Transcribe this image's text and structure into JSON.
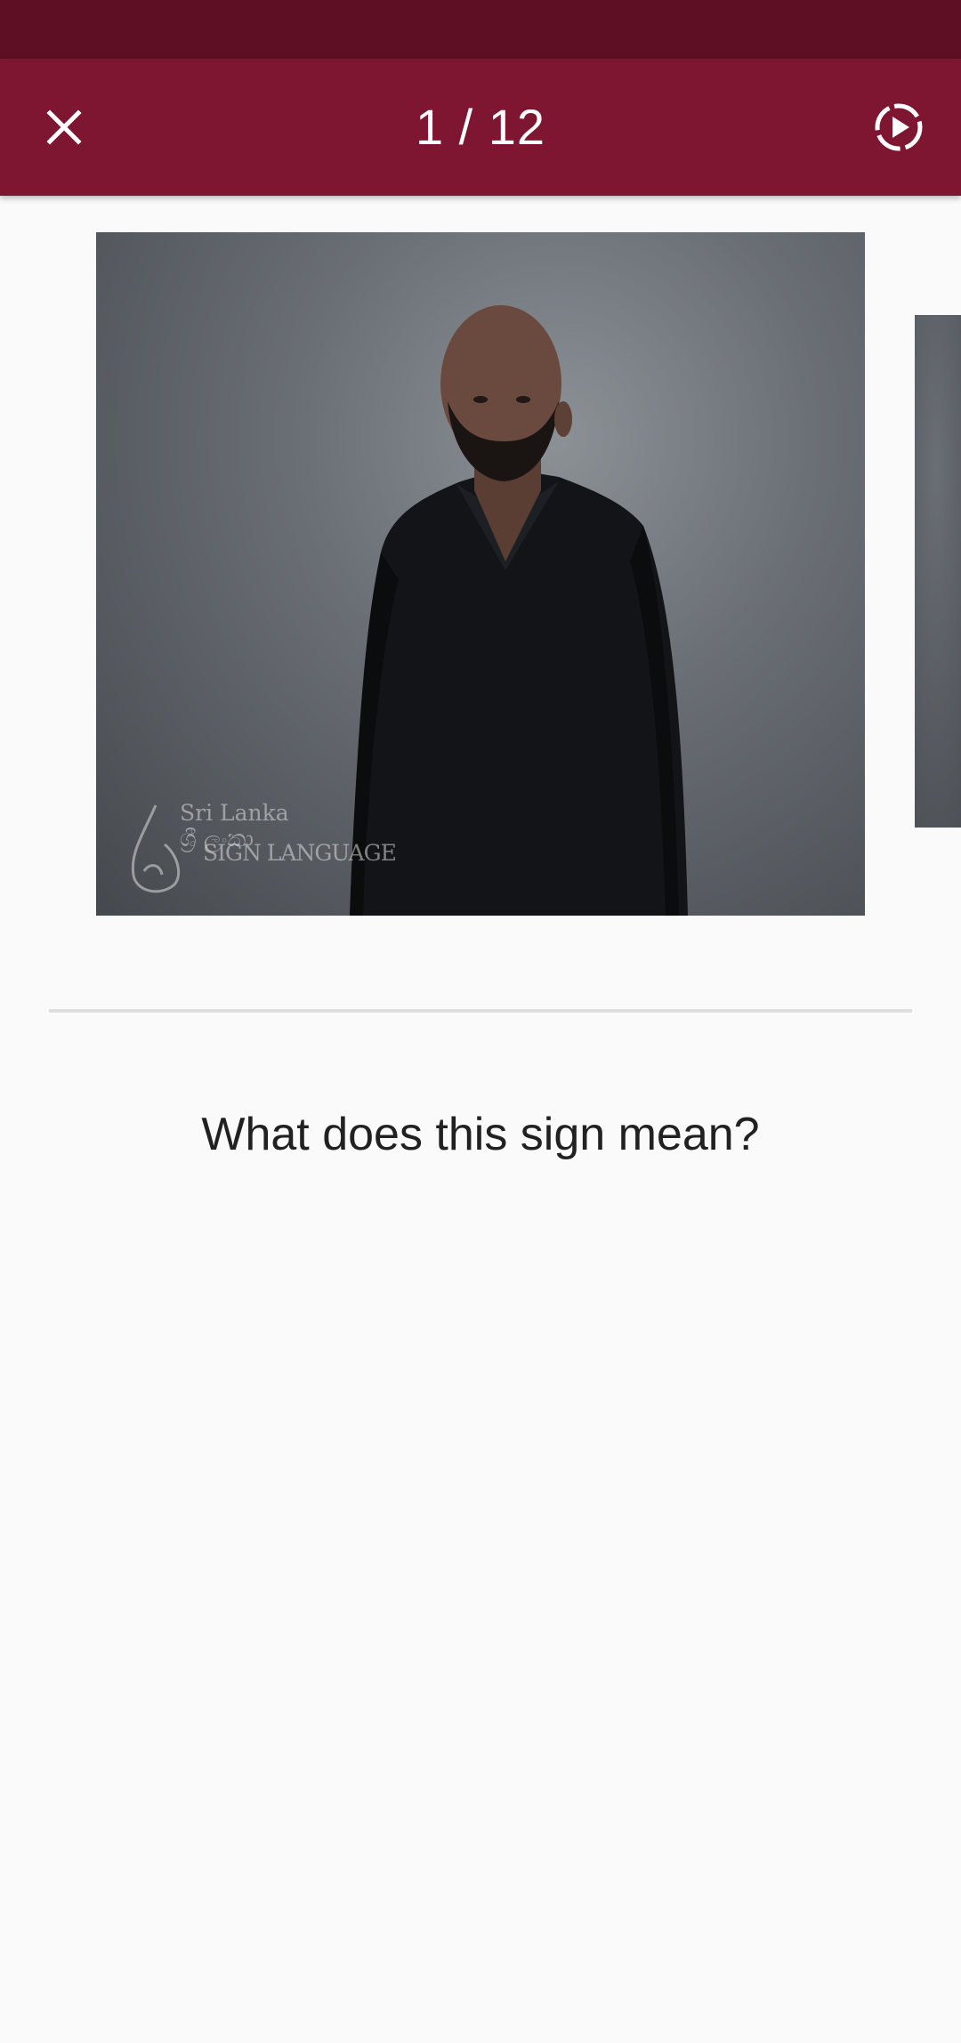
{
  "app_bar": {
    "progress": "1 / 12",
    "close_icon": "close-icon",
    "autoplay_icon": "play-circle-dashed-icon",
    "color": "#7e1531",
    "status_bar_color": "#5e0f23"
  },
  "media": {
    "watermark_line1": "Sri Lanka",
    "watermark_sinhala": "ශ්‍රී ලංකා",
    "watermark_line2": "SIGN LANGUAGE"
  },
  "quiz": {
    "question": "What does this sign mean?"
  }
}
